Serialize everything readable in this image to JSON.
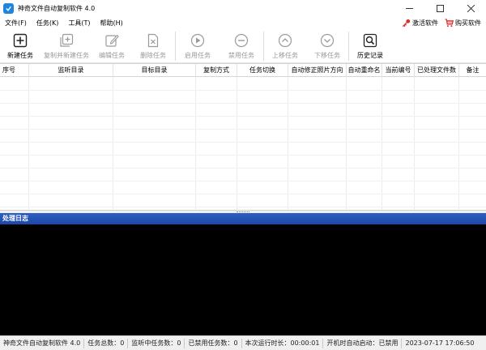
{
  "window": {
    "title": "神奇文件自动复制软件 4.0",
    "controls": [
      "minimize",
      "maximize",
      "close"
    ]
  },
  "menu": {
    "items": [
      {
        "label": "文件(F)"
      },
      {
        "label": "任务(K)"
      },
      {
        "label": "工具(T)"
      },
      {
        "label": "帮助(H)"
      }
    ],
    "activate": {
      "label": "激活软件",
      "icon": "key-icon",
      "color": "#d9302c"
    },
    "buy": {
      "label": "购买软件",
      "icon": "cart-icon",
      "color": "#d9302c"
    }
  },
  "toolbar": {
    "buttons": [
      {
        "label": "新建任务",
        "icon": "new-task-icon",
        "enabled": true
      },
      {
        "label": "复制并新建任务",
        "icon": "copy-new-task-icon",
        "enabled": false
      },
      {
        "label": "编辑任务",
        "icon": "edit-task-icon",
        "enabled": false
      },
      {
        "label": "删除任务",
        "icon": "delete-task-icon",
        "enabled": false
      },
      {
        "label": "启用任务",
        "icon": "play-icon",
        "enabled": false
      },
      {
        "label": "禁用任务",
        "icon": "minus-circle-icon",
        "enabled": false
      },
      {
        "label": "上移任务",
        "icon": "up-circle-icon",
        "enabled": false
      },
      {
        "label": "下移任务",
        "icon": "down-circle-icon",
        "enabled": false
      },
      {
        "label": "历史记录",
        "icon": "history-search-icon",
        "enabled": true
      }
    ]
  },
  "table": {
    "columns": [
      "序号",
      "监听目录",
      "目标目录",
      "复制方式",
      "任务切换",
      "自动修正照片方向",
      "自动重命名",
      "当前编号",
      "已处理文件数",
      "备注"
    ],
    "rows": []
  },
  "log": {
    "title": "处理日志",
    "background": "#000000"
  },
  "status": {
    "app_name": "神奇文件自动复制软件 4.0",
    "total_tasks": "任务总数：0",
    "listening_tasks": "监听中任务数：0",
    "disabled_tasks": "已禁用任务数：0",
    "run_time": "本次运行时长：00:00:01",
    "autostart": "开机时自动启动：已禁用",
    "datetime": "2023-07-17 17:06:50"
  },
  "colors": {
    "accent": "#1f86e0",
    "log_header": "#2353b8",
    "disabled_text": "#9a9a9a"
  }
}
